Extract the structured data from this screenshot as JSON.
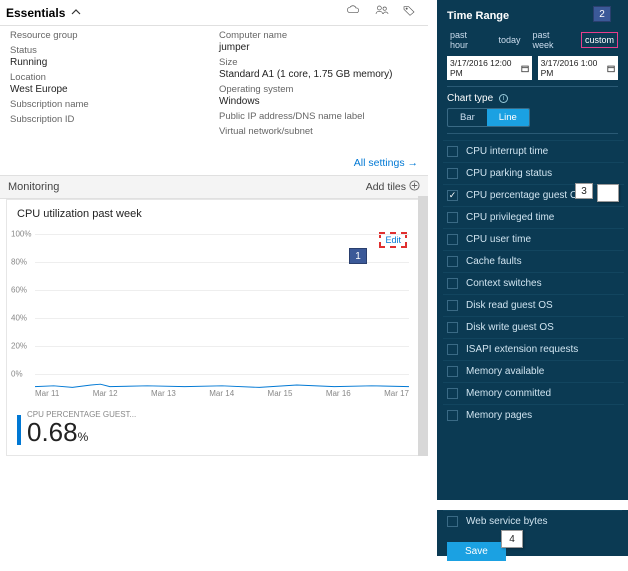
{
  "essentials": {
    "title": "Essentials",
    "fields": {
      "resource_group_label": "Resource group",
      "resource_group_value": "",
      "computer_name_label": "Computer name",
      "computer_name_value": "jumper",
      "status_label": "Status",
      "status_value": "Running",
      "size_label": "Size",
      "size_value": "Standard A1 (1 core, 1.75 GB memory)",
      "location_label": "Location",
      "location_value": "West Europe",
      "os_label": "Operating system",
      "os_value": "Windows",
      "subscription_name_label": "Subscription name",
      "subscription_name_value": "",
      "public_ip_label": "Public IP address/DNS name label",
      "public_ip_value": "",
      "subscription_id_label": "Subscription ID",
      "subscription_id_value": "",
      "vnet_label": "Virtual network/subnet",
      "vnet_value": ""
    },
    "all_settings": "All settings →"
  },
  "monitoring": {
    "header": "Monitoring",
    "add_tiles": "Add tiles",
    "chart_title": "CPU utilization past week",
    "edit_label": "Edit",
    "summary_label": "CPU PERCENTAGE GUEST...",
    "summary_value": "0.68",
    "summary_unit": "%"
  },
  "chart_data": {
    "type": "line",
    "title": "CPU utilization past week",
    "xlabel": "",
    "ylabel": "",
    "ylim": [
      0,
      100
    ],
    "y_ticks": [
      "100%",
      "80%",
      "60%",
      "40%",
      "20%",
      "0%"
    ],
    "categories": [
      "Mar 11",
      "Mar 12",
      "Mar 13",
      "Mar 14",
      "Mar 15",
      "Mar 16",
      "Mar 17"
    ],
    "series": [
      {
        "name": "CPU percentage guest OS",
        "values": [
          1,
          1,
          1,
          1,
          1,
          1,
          1
        ]
      }
    ]
  },
  "time_range": {
    "title": "Time Range",
    "options": {
      "past_hour": "past hour",
      "today": "today",
      "past_week": "past week",
      "custom": "custom"
    },
    "selected": "custom",
    "start": "3/17/2016 12:00 PM",
    "end": "3/17/2016 1:00 PM",
    "chart_type_label": "Chart type",
    "chart_type_options": {
      "bar": "Bar",
      "line": "Line"
    },
    "chart_type_selected": "line"
  },
  "metrics": [
    {
      "label": "CPU interrupt time",
      "checked": false
    },
    {
      "label": "CPU parking status",
      "checked": false
    },
    {
      "label": "CPU percentage guest OS",
      "checked": true
    },
    {
      "label": "CPU privileged time",
      "checked": false
    },
    {
      "label": "CPU user time",
      "checked": false
    },
    {
      "label": "Cache faults",
      "checked": false
    },
    {
      "label": "Context switches",
      "checked": false
    },
    {
      "label": "Disk read guest OS",
      "checked": false
    },
    {
      "label": "Disk write guest OS",
      "checked": false
    },
    {
      "label": "ISAPI extension requests",
      "checked": false
    },
    {
      "label": "Memory available",
      "checked": false
    },
    {
      "label": "Memory committed",
      "checked": false
    },
    {
      "label": "Memory pages",
      "checked": false
    }
  ],
  "extra_metric": {
    "label": "Web service bytes",
    "checked": false
  },
  "save_label": "Save",
  "callouts": {
    "c1": "1",
    "c2": "2",
    "c3": "3",
    "c4": "4"
  }
}
